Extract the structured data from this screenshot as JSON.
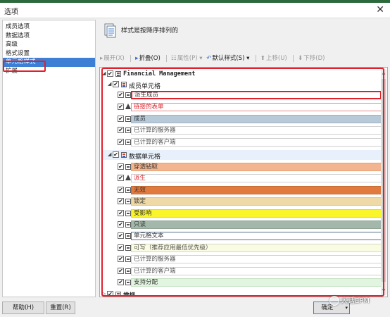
{
  "window": {
    "title": "选项",
    "close_glyph": "✕",
    "accent_color": "#2c6a3b"
  },
  "sidebar": {
    "items": [
      {
        "label": "成员选项"
      },
      {
        "label": "数据选项"
      },
      {
        "label": "高级"
      },
      {
        "label": "格式设置"
      },
      {
        "label": "单元格样式",
        "selected": true
      },
      {
        "label": "扩展"
      }
    ]
  },
  "header": {
    "icon": "document-list-icon",
    "text": "样式是按降序排列的"
  },
  "toolbar": {
    "expand": {
      "glyph": "▸",
      "label": "展开(X)",
      "enabled": false
    },
    "collapse": {
      "glyph": "▸",
      "label": "折叠(O)",
      "enabled": true
    },
    "properties": {
      "glyph": "☷",
      "label": "属性(P) ▾",
      "enabled": false
    },
    "default_style": {
      "glyph": "↶",
      "label": "默认样式(S) ▾",
      "enabled": true
    },
    "move_up": {
      "glyph": "⬆",
      "label": "上移(U)",
      "enabled": false
    },
    "move_down": {
      "glyph": "⬇",
      "label": "下移(D)",
      "enabled": false
    }
  },
  "tree": {
    "root": {
      "label": "Financial Management",
      "arrow": "◢",
      "check": "✔"
    },
    "member_group": {
      "label": "成员单元格",
      "arrow": "◢",
      "check": "✔"
    },
    "member_styles": [
      {
        "label": "派生成员",
        "icon": "box",
        "bg": "#ffffff",
        "border": "#e0212b",
        "text": "#333333",
        "hl": true
      },
      {
        "label": "链接的表单",
        "icon": "tri",
        "bg": "#ffffff",
        "border": "#e38b86",
        "text": "#e0212b"
      },
      {
        "label": "成员",
        "icon": "box",
        "bg": "#b8c9d8",
        "border": "#9fb3c6",
        "text": "#333333"
      },
      {
        "label": "已计算的服务器",
        "icon": "box",
        "bg": "#ffffff",
        "border": "#cfcfcf",
        "text": "#555555"
      },
      {
        "label": "已计算的客户端",
        "icon": "box",
        "bg": "#ffffff",
        "border": "#cfcfcf",
        "text": "#555555"
      }
    ],
    "data_group": {
      "label": "数据单元格",
      "arrow": "◢",
      "check": "✔"
    },
    "data_styles": [
      {
        "label": "穿透钻取",
        "icon": "box",
        "bg": "#f2b58f",
        "border": "#e8a27a",
        "text": "#333333"
      },
      {
        "label": "派生",
        "icon": "tri",
        "bg": "#ffffff",
        "border": "#cfcfcf",
        "text": "#e0212b"
      },
      {
        "label": "无效",
        "icon": "box",
        "bg": "#e07a3f",
        "border": "#c86a35",
        "text": "#333333"
      },
      {
        "label": "锁定",
        "icon": "box",
        "bg": "#efd9a6",
        "border": "#dcc48e",
        "text": "#333333"
      },
      {
        "label": "受影响",
        "icon": "box",
        "bg": "#f9f52a",
        "border": "#e0dc20",
        "text": "#333333"
      },
      {
        "label": "只读",
        "icon": "box",
        "bg": "#a3b8ab",
        "border": "#8da593",
        "text": "#333333"
      },
      {
        "label": "单元格文本",
        "icon": "box",
        "bg": "#ffffff",
        "border": "#5a6f8c",
        "text": "#333333"
      },
      {
        "label": "可写（推荐应用最低优先级）",
        "icon": "box",
        "bg": "#fafbe3",
        "border": "#d8d8c0",
        "text": "#555555"
      },
      {
        "label": "已计算的服务器",
        "icon": "box",
        "bg": "#ffffff",
        "border": "#cfcfcf",
        "text": "#555555"
      },
      {
        "label": "已计算的客户端",
        "icon": "box",
        "bg": "#ffffff",
        "border": "#cfcfcf",
        "text": "#555555"
      },
      {
        "label": "支持分配",
        "icon": "box",
        "bg": "#e2f5e0",
        "border": "#c4e2c0",
        "text": "#333333"
      }
    ],
    "general_group": {
      "label": "常规",
      "arrow": "▷",
      "check": "✔"
    }
  },
  "buttons": {
    "help": "帮助(H)",
    "reset": "重置(R)",
    "ok": "确定",
    "ok_arrow": "▾"
  },
  "watermark": {
    "text": "大话EPM"
  },
  "highlight_color": "#e0212b"
}
